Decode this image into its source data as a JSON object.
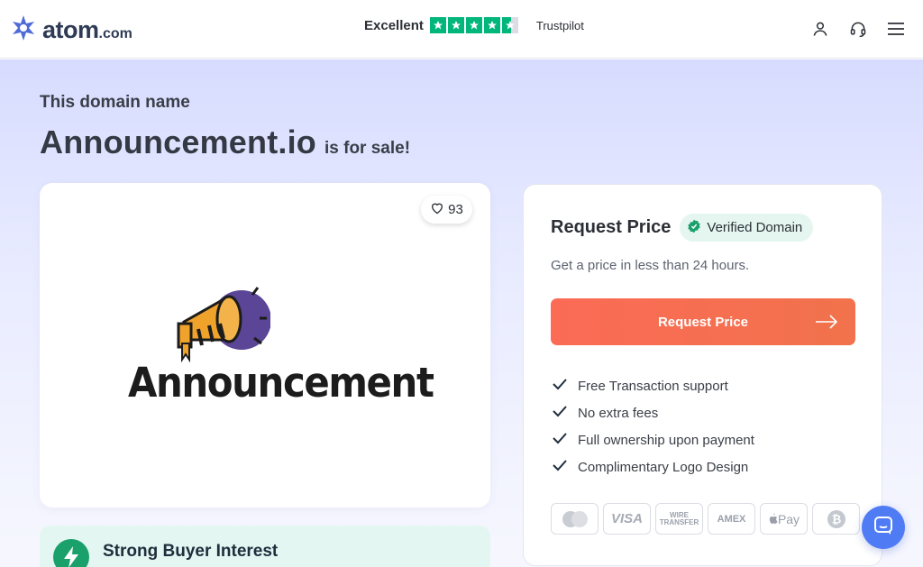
{
  "header": {
    "brand_name": "atom",
    "brand_tld": ".com",
    "rating_label": "Excellent",
    "rating_stars": 4.5,
    "rating_provider": "Trustpilot",
    "icons": [
      "user-icon",
      "headset-icon",
      "menu-icon"
    ]
  },
  "hero": {
    "overline": "This domain name",
    "domain": "Announcement.io",
    "for_sale": "is for sale!"
  },
  "logo_card": {
    "likes": "93",
    "logo_text": "Announcement"
  },
  "interest": {
    "title": "Strong Buyer Interest"
  },
  "price_card": {
    "title": "Request Price",
    "badge": "Verified Domain",
    "subtitle": "Get a price in less than 24 hours.",
    "cta_label": "Request Price",
    "benefits": [
      "Free Transaction support",
      "No extra fees",
      "Full ownership upon payment",
      "Complimentary Logo Design"
    ],
    "payments": [
      "mastercard",
      "VISA",
      "WIRE TRANSFER",
      "AMEX",
      "Pay",
      "bitcoin"
    ]
  },
  "colors": {
    "accent": "#fb6b56",
    "trust_green": "#00b67a",
    "verified_green": "#19a06b",
    "chat_blue": "#4f7cf5"
  }
}
